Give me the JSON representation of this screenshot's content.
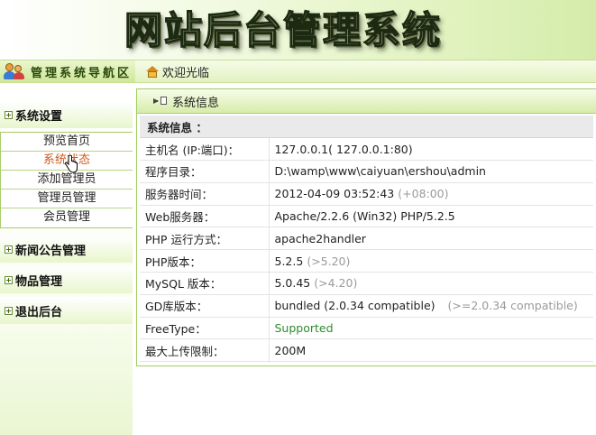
{
  "banner": {
    "title": "网站后台管理系统"
  },
  "topbar": {
    "nav_title": "管理系统导航区",
    "welcome": "欢迎光临"
  },
  "sidebar": {
    "groups": [
      {
        "label": "系统设置",
        "items": [
          "预览首页",
          "系统状态",
          "添加管理员",
          "管理员管理",
          "会员管理"
        ],
        "active": "系统状态"
      },
      {
        "label": "新闻公告管理"
      },
      {
        "label": "物品管理"
      },
      {
        "label": "退出后台"
      }
    ]
  },
  "panel": {
    "title": "系统信息",
    "section": "系统信息 ：",
    "rows": [
      {
        "label": "主机名 (IP:端口)：",
        "value": "127.0.0.1( 127.0.0.1:80)"
      },
      {
        "label": "程序目录：",
        "value": "D:\\wamp\\www\\caiyuan\\ershou\\admin"
      },
      {
        "label": "服务器时间：",
        "value": "2012-04-09 03:52:43",
        "hint": "(+08:00)"
      },
      {
        "label": "Web服务器：",
        "value": "Apache/2.2.6 (Win32) PHP/5.2.5"
      },
      {
        "label": "PHP 运行方式：",
        "value": "apache2handler"
      },
      {
        "label": "PHP版本：",
        "value": "5.2.5",
        "hint": "(>5.20)"
      },
      {
        "label": "MySQL 版本：",
        "value": "5.0.45",
        "hint": "(>4.20)"
      },
      {
        "label": "GD库版本：",
        "value": "bundled (2.0.34 compatible)",
        "hint": "(>=2.0.34 compatible)"
      },
      {
        "label": "FreeType：",
        "value": "Supported"
      },
      {
        "label": "最大上传限制：",
        "value": "200M"
      }
    ]
  },
  "colors": {
    "accent_green": "#9fcf5e",
    "active_link": "#d0581a",
    "supported": "#2e8b2e",
    "hint_gray": "#9a9a9a"
  }
}
